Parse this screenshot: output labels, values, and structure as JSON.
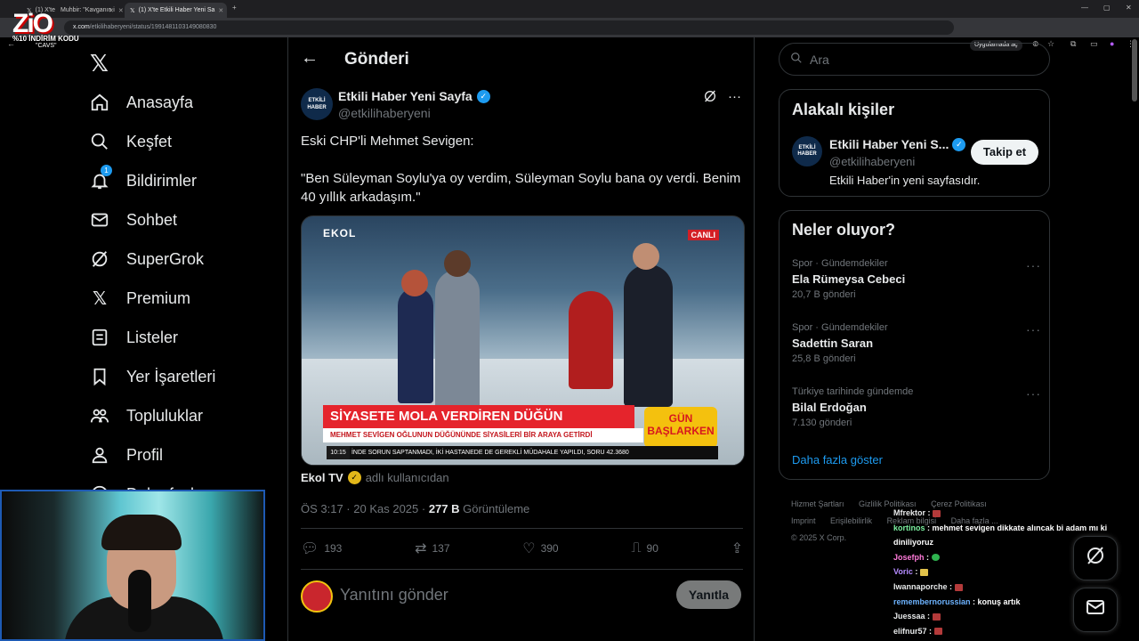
{
  "browser": {
    "tabs": [
      {
        "title": "(1) X'te",
        "active": false
      },
      {
        "title": "Muhbir: \"Kavganın i",
        "active": false
      },
      {
        "title": "(1) X'te Etkili Haber Yeni Sa",
        "active": true
      }
    ],
    "url_host": "x.com",
    "url_path": "/etkilihaberyeni/status/1991481103149080830",
    "app_button": "Uygulamada aç",
    "overlay_logo": "ZiO",
    "overlay_promo": "%10 İNDİRİM KODU",
    "overlay_code": "\"CAVS\""
  },
  "nav": {
    "items": [
      {
        "label": "Anasayfa",
        "icon": "home-icon"
      },
      {
        "label": "Keşfet",
        "icon": "search-icon"
      },
      {
        "label": "Bildirimler",
        "icon": "bell-icon",
        "badge": "1"
      },
      {
        "label": "Sohbet",
        "icon": "mail-icon"
      },
      {
        "label": "SuperGrok",
        "icon": "grok-icon"
      },
      {
        "label": "Premium",
        "icon": "x-icon"
      },
      {
        "label": "Listeler",
        "icon": "list-icon"
      },
      {
        "label": "Yer İşaretleri",
        "icon": "bookmark-icon"
      },
      {
        "label": "Topluluklar",
        "icon": "people-icon"
      },
      {
        "label": "Profil",
        "icon": "user-icon"
      },
      {
        "label": "Daha fazla",
        "icon": "more-icon"
      }
    ]
  },
  "header": {
    "title": "Gönderi"
  },
  "post": {
    "author": "Etkili Haber Yeni Sayfa",
    "handle": "@etkilihaberyeni",
    "avatar_line1": "ETKİLİ",
    "avatar_line2": "HABER",
    "text_line1": "Eski CHP'li Mehmet Sevigen:",
    "text_line2": "\"Ben Süleyman Soylu'ya oy verdim, Süleyman Soylu bana oy verdi. Benim 40 yıllık arkadaşım.\"",
    "media": {
      "channel": "EKOL",
      "live": "CANLI",
      "headline": "SİYASETE MOLA VERDİREN DÜĞÜN",
      "subheadline": "MEHMET SEVİGEN OĞLUNUN DÜĞÜNÜNDE SİYASİLERİ BİR ARAYA GETİRDİ",
      "ticker_time": "10:15",
      "ticker_text": "İNDE SORUN SAPTANMADI, İKİ HASTANEDE DE GEREKLİ MÜDAHALE YAPILDI, SORU",
      "ticker_num": "42.3680",
      "badge_line1": "GÜN",
      "badge_line2": "BAŞLARKEN"
    },
    "source_name": "Ekol TV",
    "source_suffix": "adlı kullanıcıdan",
    "time": "ÖS 3:17 · 20 Kas 2025 · ",
    "views": "277 B",
    "views_label": " Görüntüleme",
    "replies": "193",
    "reposts": "137",
    "likes": "390",
    "bookmarks": "90",
    "reply_placeholder": "Yanıtını gönder",
    "reply_button": "Yanıtla"
  },
  "search": {
    "placeholder": "Ara"
  },
  "related": {
    "title": "Alakalı kişiler",
    "name": "Etkili Haber Yeni S...",
    "handle": "@etkilihaberyeni",
    "bio": "Etkili Haber'in yeni sayfasıdır.",
    "follow": "Takip et"
  },
  "trends": {
    "title": "Neler oluyor?",
    "items": [
      {
        "category": "Spor · Gündemdekiler",
        "name": "Ela Rümeysa Cebeci",
        "count": "20,7 B gönderi"
      },
      {
        "category": "Spor · Gündemdekiler",
        "name": "Sadettin Saran",
        "count": "25,8 B gönderi"
      },
      {
        "category": "Türkiye tarihinde gündemde",
        "name": "Bilal Erdoğan",
        "count": "7.130 gönderi"
      }
    ],
    "show_more": "Daha fazla göster"
  },
  "footer": {
    "links": [
      "Hizmet Şartları",
      "Gizlilik Politikası",
      "Çerez Politikası",
      "Imprint",
      "Erişilebilirlik",
      "Reklam bilgisi",
      "Daha fazla ..."
    ],
    "copyright": "© 2025 X Corp."
  },
  "chat": [
    {
      "user": "Mfrektor",
      "msg": "",
      "color": "#e7e9ea",
      "emote": true
    },
    {
      "user": "kortinos",
      "msg": "mehmet sevigen dikkate alıncak bi adam mı ki diniliyoruz",
      "color": "#7cf0a0",
      "emote": false
    },
    {
      "user": "Josefph",
      "msg": "",
      "color": "#ff7ad9",
      "emote": true
    },
    {
      "user": "Voric",
      "msg": "",
      "color": "#b48bff",
      "emote": true
    },
    {
      "user": "Iwannaporche",
      "msg": "",
      "color": "#e7e9ea",
      "emote": true
    },
    {
      "user": "remembernorussian",
      "msg": "konuş artık",
      "color": "#6db3ff",
      "emote": false
    },
    {
      "user": "Juessaa",
      "msg": "",
      "color": "#e7e9ea",
      "emote": true
    },
    {
      "user": "elifnur57",
      "msg": "",
      "color": "#e7e9ea",
      "emote": true
    }
  ]
}
